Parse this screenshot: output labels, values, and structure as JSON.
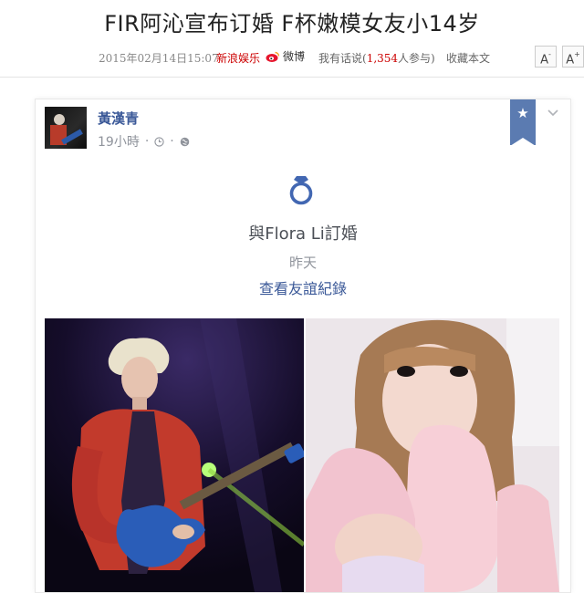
{
  "article": {
    "headline": "FIR阿沁宣布订婚 F杯嫩模女友小14岁",
    "date": "2015年02月14日15:07",
    "source": "新浪娱乐",
    "weibo": "微博",
    "comments_prefix": "我有话说(",
    "comments_count": "1,354",
    "comments_suffix": "人参与)",
    "collect": "收藏本文",
    "font_minus": "A",
    "font_minus_sup": "-",
    "font_plus": "A",
    "font_plus_sup": "+"
  },
  "post": {
    "user_name": "黃漢青",
    "time": "19小時",
    "separator": "·",
    "event_title": "與Flora Li訂婚",
    "event_date": "昨天",
    "event_link": "查看友誼紀錄"
  },
  "icons": {
    "weibo": "weibo-icon",
    "clock": "clock-icon",
    "globe": "globe-icon",
    "star": "star-icon",
    "chevron": "chevron-down-icon",
    "ring": "ring-icon"
  },
  "colors": {
    "link_blue": "#3b5998",
    "accent_red": "#cc0000",
    "bookmark": "#5b7bb1",
    "ring": "#4267b2"
  }
}
